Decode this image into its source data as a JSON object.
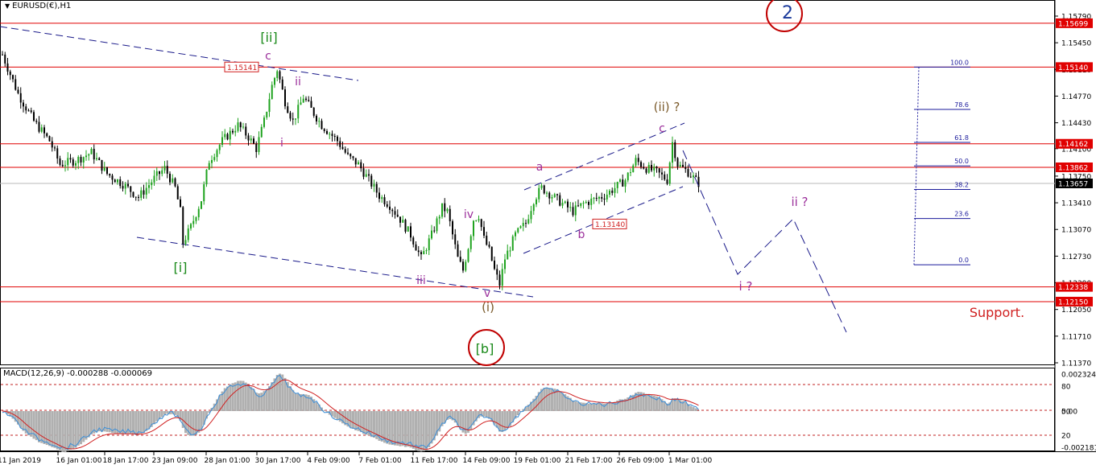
{
  "window": {
    "symbol_title": "EURUSD(€),H1",
    "dropdown_icon": "triangle-down-icon"
  },
  "chart_data": {
    "type": "candlestick",
    "symbol": "EURUSD",
    "timeframe": "H1",
    "ylim": [
      1.1137,
      1.1579
    ],
    "price_ticks": [
      "1.15790",
      "1.15450",
      "1.15110",
      "1.14770",
      "1.14430",
      "1.14100",
      "1.13750",
      "1.13410",
      "1.13070",
      "1.12730",
      "1.12390",
      "1.12050",
      "1.11710",
      "1.11370"
    ],
    "time_ticks": [
      "11 Jan 2019",
      "16 Jan 01:00",
      "18 Jan 17:00",
      "23 Jan 09:00",
      "28 Jan 01:00",
      "30 Jan 17:00",
      "4 Feb 09:00",
      "7 Feb 01:00",
      "11 Feb 17:00",
      "14 Feb 09:00",
      "19 Feb 01:00",
      "21 Feb 17:00",
      "26 Feb 09:00",
      "1 Mar 01:00"
    ],
    "price_path": [
      [
        0,
        1.153
      ],
      [
        6,
        1.148
      ],
      [
        12,
        1.1445
      ],
      [
        18,
        1.142
      ],
      [
        22,
        1.139
      ],
      [
        28,
        1.1395
      ],
      [
        34,
        1.1405
      ],
      [
        40,
        1.1378
      ],
      [
        46,
        1.1365
      ],
      [
        52,
        1.1348
      ],
      [
        58,
        1.1372
      ],
      [
        62,
        1.1385
      ],
      [
        66,
        1.136
      ],
      [
        68,
        1.133
      ],
      [
        69,
        1.129
      ],
      [
        72,
        1.131
      ],
      [
        76,
        1.1345
      ],
      [
        79,
        1.1395
      ],
      [
        84,
        1.142
      ],
      [
        90,
        1.144
      ],
      [
        94,
        1.1425
      ],
      [
        97,
        1.141
      ],
      [
        100,
        1.1445
      ],
      [
        103,
        1.149
      ],
      [
        105,
        1.1511
      ],
      [
        108,
        1.147
      ],
      [
        111,
        1.1445
      ],
      [
        113,
        1.146
      ],
      [
        115,
        1.1476
      ],
      [
        118,
        1.146
      ],
      [
        122,
        1.144
      ],
      [
        128,
        1.142
      ],
      [
        132,
        1.14
      ],
      [
        136,
        1.139
      ],
      [
        140,
        1.137
      ],
      [
        144,
        1.135
      ],
      [
        148,
        1.1338
      ],
      [
        152,
        1.132
      ],
      [
        156,
        1.13
      ],
      [
        160,
        1.127
      ],
      [
        164,
        1.13
      ],
      [
        168,
        1.1335
      ],
      [
        170,
        1.133
      ],
      [
        172,
        1.13
      ],
      [
        174,
        1.127
      ],
      [
        176,
        1.1255
      ],
      [
        178,
        1.1285
      ],
      [
        180,
        1.132
      ],
      [
        182,
        1.1325
      ],
      [
        184,
        1.1295
      ],
      [
        186,
        1.128
      ],
      [
        188,
        1.1255
      ],
      [
        190,
        1.1237
      ],
      [
        192,
        1.127
      ],
      [
        196,
        1.13
      ],
      [
        200,
        1.1315
      ],
      [
        203,
        1.1345
      ],
      [
        206,
        1.136
      ],
      [
        210,
        1.135
      ],
      [
        214,
        1.134
      ],
      [
        218,
        1.133
      ],
      [
        222,
        1.134
      ],
      [
        226,
        1.1345
      ],
      [
        230,
        1.135
      ],
      [
        234,
        1.136
      ],
      [
        238,
        1.137
      ],
      [
        242,
        1.1395
      ],
      [
        246,
        1.1385
      ],
      [
        250,
        1.138
      ],
      [
        254,
        1.137
      ],
      [
        256,
        1.1418
      ],
      [
        258,
        1.139
      ],
      [
        262,
        1.138
      ],
      [
        266,
        1.1366
      ]
    ],
    "macd": {
      "params": "MACD(12,26,9)",
      "main": -0.000288,
      "signal": -6.9e-05,
      "ticks": [
        "0.002324",
        "80",
        "50",
        "0.00",
        "20",
        "-0.002181"
      ]
    },
    "horizontal_levels": [
      {
        "price": 1.15699,
        "label": "1.15699",
        "color": "#e00000"
      },
      {
        "price": 1.1514,
        "label": "1.15140",
        "color": "#e00000"
      },
      {
        "price": 1.14162,
        "label": "1.14162",
        "color": "#e00000"
      },
      {
        "price": 1.13862,
        "label": "1.13862",
        "color": "#e00000"
      },
      {
        "price": 1.12338,
        "label": "1.12338",
        "color": "#e00000"
      },
      {
        "price": 1.1215,
        "label": "1.12150",
        "color": "#e00000"
      }
    ],
    "current_price": {
      "price": 1.13657,
      "label": "1.13657"
    },
    "price_labels": [
      {
        "label": "1.15141",
        "price": 1.15141
      },
      {
        "label": "1.13140",
        "price": 1.1314
      }
    ],
    "fibonacci": [
      {
        "level": "100.0",
        "price": 1.1514
      },
      {
        "level": "78.6",
        "price": 1.146
      },
      {
        "level": "61.8",
        "price": 1.1418
      },
      {
        "level": "50.0",
        "price": 1.1388
      },
      {
        "level": "38.2",
        "price": 1.1358
      },
      {
        "level": "23.6",
        "price": 1.1321
      },
      {
        "level": "0.0",
        "price": 1.1262
      }
    ],
    "wave_labels": [
      {
        "text": "[ii]",
        "color": "#1a8a1a"
      },
      {
        "text": "c",
        "color": "#9b2f9b"
      },
      {
        "text": "ii",
        "color": "#9b2f9b"
      },
      {
        "text": "i",
        "color": "#9b2f9b"
      },
      {
        "text": "[i]",
        "color": "#1a8a1a"
      },
      {
        "text": "iii",
        "color": "#9b2f9b"
      },
      {
        "text": "iv",
        "color": "#9b2f9b"
      },
      {
        "text": "v",
        "color": "#9b2f9b"
      },
      {
        "text": "(i)",
        "color": "#7a5a2a"
      },
      {
        "text": "[b]",
        "color": "#1a8a1a"
      },
      {
        "text": "a",
        "color": "#9b2f9b"
      },
      {
        "text": "b",
        "color": "#9b2f9b"
      },
      {
        "text": "c",
        "color": "#9b2f9b"
      },
      {
        "text": "(ii) ?",
        "color": "#7a5a2a"
      },
      {
        "text": "ii ?",
        "color": "#9b2f9b"
      },
      {
        "text": "i ?",
        "color": "#9b2f9b"
      },
      {
        "text": "2",
        "color": "#1a3a9b"
      }
    ],
    "annotations": [
      {
        "text": "Support.",
        "color": "#d02020"
      }
    ],
    "colors": {
      "bull_candle": "#1fa31f",
      "bear_candle": "#000000",
      "level_line": "#e00000",
      "trendline": "#1a1a8a",
      "macd_main": "#3a8ed8",
      "macd_signal": "#d02020",
      "macd_hist": "#b0b0b0"
    }
  }
}
